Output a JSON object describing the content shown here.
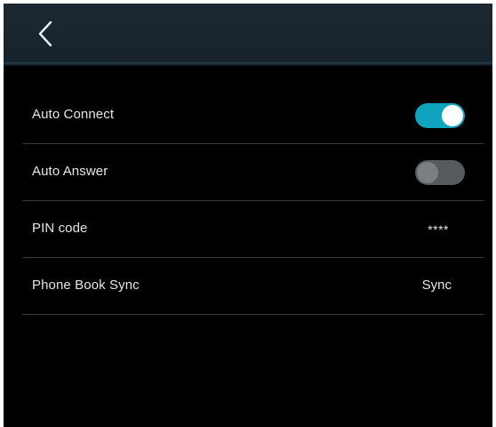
{
  "header": {
    "back_icon": "chevron-left-icon"
  },
  "settings": {
    "auto_connect": {
      "label": "Auto Connect",
      "enabled": true
    },
    "auto_answer": {
      "label": "Auto Answer",
      "enabled": false
    },
    "pin_code": {
      "label": "PIN code",
      "value": "****"
    },
    "phone_book_sync": {
      "label": "Phone Book Sync",
      "action_label": "Sync"
    }
  },
  "colors": {
    "accent": "#0fa3bf",
    "background": "#000000",
    "header": "#1c2832",
    "divider": "#2e3c46",
    "text": "#e6e6e6"
  }
}
